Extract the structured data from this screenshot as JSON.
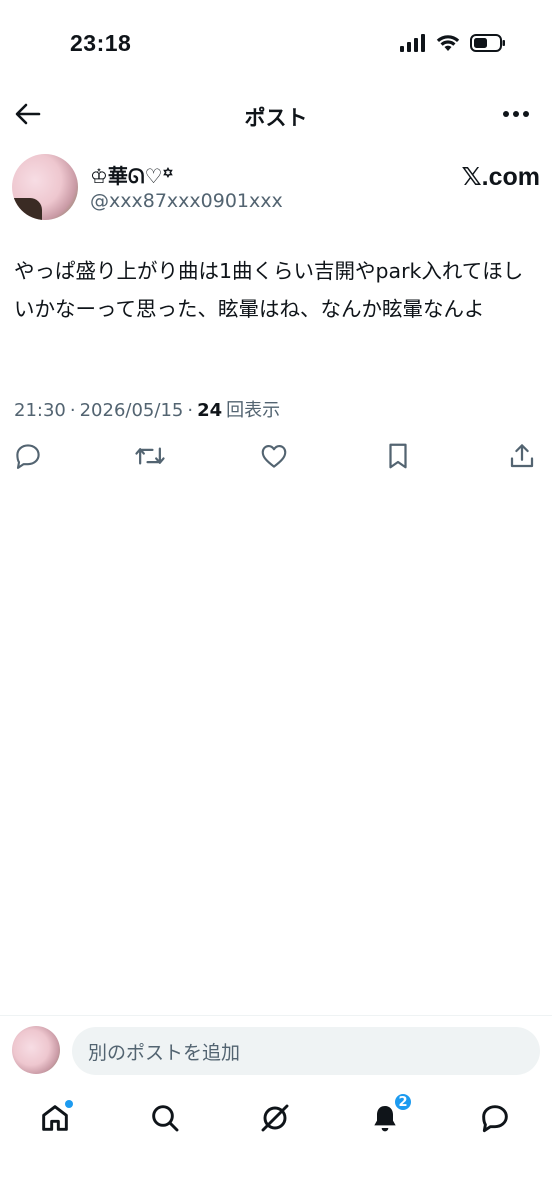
{
  "status": {
    "time": "23:18",
    "icons": [
      "signal-icon",
      "wifi-icon",
      "battery-icon"
    ]
  },
  "header": {
    "title": "ポスト",
    "back_icon": "back-arrow-icon",
    "more_icon": "more-icon"
  },
  "author": {
    "display_name": "♔華ᘏ♡꙳",
    "handle": "@xxx87xxx0901xxx",
    "watermark": "𝕏.com"
  },
  "post": {
    "text": "やっぱ盛り上がり曲は1曲くらい吉開やpark入れてほしいかなーって思った、眩暈はね、なんか眩暈なんよ"
  },
  "meta": {
    "time": "21:30",
    "date": "2026/05/15",
    "separator": "·",
    "views_count": "24",
    "views_label": "回表示"
  },
  "actions": [
    "reply-icon",
    "repost-icon",
    "like-icon",
    "bookmark-icon",
    "share-icon"
  ],
  "composer": {
    "placeholder": "別のポストを追加"
  },
  "nav": {
    "items": [
      "home-icon",
      "search-icon",
      "grok-icon",
      "notifications-icon",
      "messages-icon"
    ],
    "notification_badge": "2"
  },
  "colors": {
    "text": "#0f1419",
    "secondary": "#536471",
    "accent": "#1d9bf0",
    "divider": "#eff3f4"
  }
}
